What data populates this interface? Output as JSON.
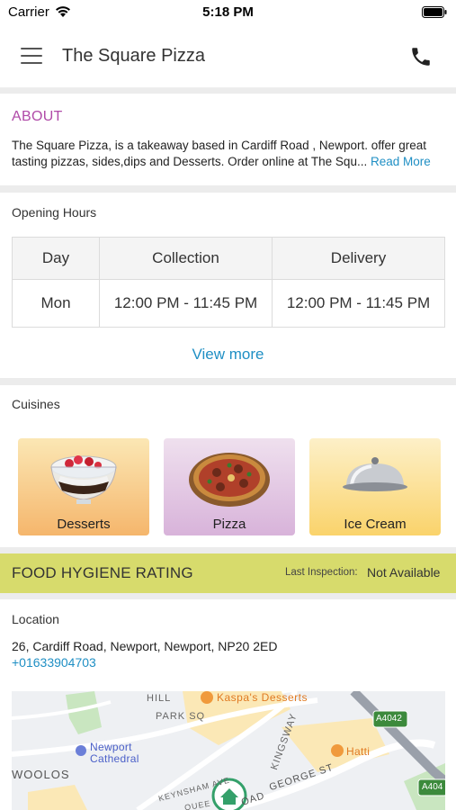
{
  "status_bar": {
    "carrier": "Carrier",
    "time": "5:18 PM"
  },
  "navbar": {
    "title": "The Square Pizza",
    "menu_icon": "hamburger-icon",
    "phone_icon": "phone-icon"
  },
  "about": {
    "heading": "ABOUT",
    "text": "The Square Pizza, is a takeaway based in Cardiff Road , Newport. offer great tasting  pizzas, sides,dips and Desserts. Order online at The Squ...",
    "read_more": "Read More"
  },
  "opening_hours": {
    "label": "Opening Hours",
    "columns": [
      "Day",
      "Collection",
      "Delivery"
    ],
    "rows": [
      {
        "day": "Mon",
        "collection": "12:00 PM - 11:45 PM",
        "delivery": "12:00 PM - 11:45 PM"
      }
    ],
    "view_more": "View more"
  },
  "cuisines": {
    "label": "Cuisines",
    "items": [
      {
        "name": "Desserts"
      },
      {
        "name": "Pizza"
      },
      {
        "name": "Ice Cream"
      }
    ]
  },
  "hygiene": {
    "title": "FOOD HYGIENE RATING",
    "last_inspection_label": "Last Inspection:",
    "last_inspection_value": "Not Available",
    "color": "#d7db6c"
  },
  "location": {
    "label": "Location",
    "address": "26, Cardiff Road, Newport, Newport, NP20 2ED",
    "phone": "+01633904703",
    "map_labels": {
      "kaspa": "Kaspa's Desserts",
      "cathedral_1": "Newport",
      "cathedral_2": "Cathedral",
      "woolos": "WOOLOS",
      "hatti": "Hatti",
      "road_a": "A4042",
      "road_b": "A404",
      "george": "GEORGE ST",
      "hill": "HILL",
      "park": "PARK SQ",
      "kingsway": "KINGSWAY",
      "keynsham": "KEYNSHAM AVE",
      "queen": "QUEE",
      "road": "OAD"
    }
  },
  "colors": {
    "accent_link": "#1f8fc4",
    "about_heading": "#b04aa8"
  }
}
